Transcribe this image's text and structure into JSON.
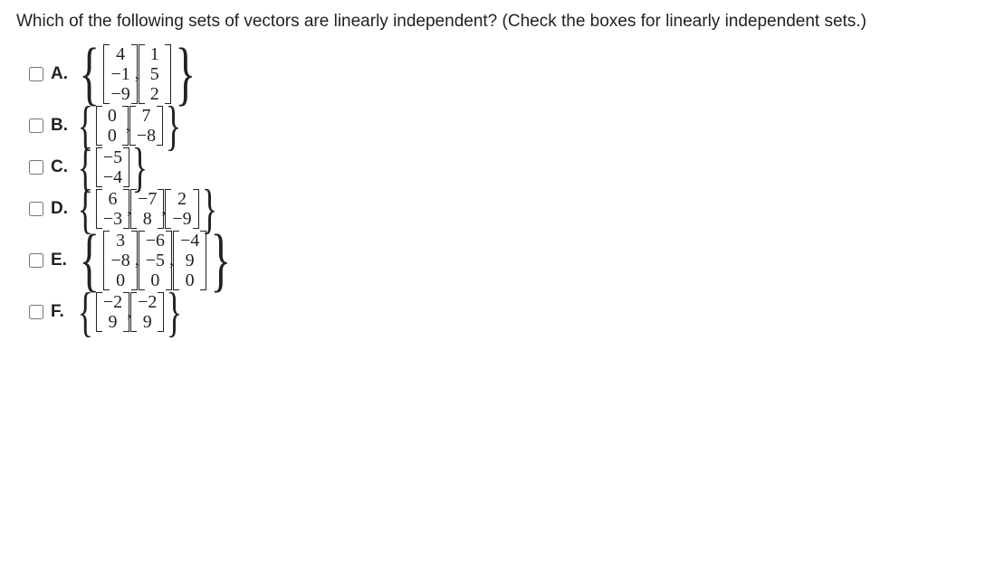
{
  "question": "Which of the following sets of vectors are linearly independent? (Check the boxes for linearly independent sets.)",
  "options": [
    {
      "letter": "A.",
      "rows": 3,
      "vectors": [
        [
          "4",
          "−1",
          "−9"
        ],
        [
          "1",
          "5",
          "2"
        ]
      ]
    },
    {
      "letter": "B.",
      "rows": 2,
      "vectors": [
        [
          "0",
          "0"
        ],
        [
          "7",
          "−8"
        ]
      ]
    },
    {
      "letter": "C.",
      "rows": 2,
      "vectors": [
        [
          "−5",
          "−4"
        ]
      ]
    },
    {
      "letter": "D.",
      "rows": 2,
      "vectors": [
        [
          "6",
          "−3"
        ],
        [
          "−7",
          "8"
        ],
        [
          "2",
          "−9"
        ]
      ]
    },
    {
      "letter": "E.",
      "rows": 3,
      "vectors": [
        [
          "3",
          "−8",
          "0"
        ],
        [
          "−6",
          "−5",
          "0"
        ],
        [
          "−4",
          "9",
          "0"
        ]
      ]
    },
    {
      "letter": "F.",
      "rows": 2,
      "vectors": [
        [
          "−2",
          "9"
        ],
        [
          "−2",
          "9"
        ]
      ]
    }
  ]
}
